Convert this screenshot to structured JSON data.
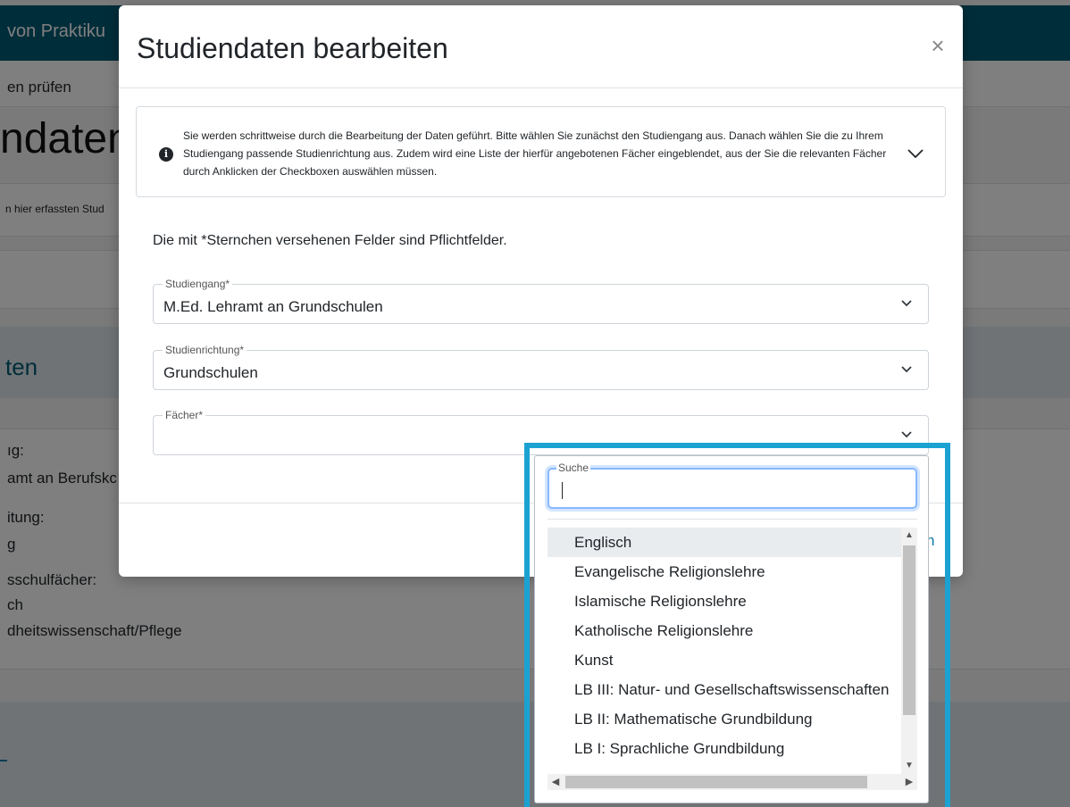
{
  "background": {
    "header_title": "von Praktiku",
    "subnav_text": "en prüfen",
    "page_title": "ndaten",
    "description": "n hier erfassten Stud",
    "section_title": "ten",
    "lines": [
      "ıg:",
      "amt an Berufskc",
      "itung:",
      "g",
      "sschulfächer:",
      "ch",
      "dheitswissenschaft/Pflege"
    ]
  },
  "modal": {
    "title": "Studiendaten bearbeiten",
    "close_symbol": "×",
    "info_icon": "i",
    "info_text": "Sie werden schrittweise durch die Bearbeitung der Daten geführt. Bitte wählen Sie zunächst den Studiengang aus. Danach wählen Sie die zu Ihrem Studiengang passende Studienrichtung aus. Zudem wird eine Liste der hierfür angebotenen Fächer eingeblendet, aus der Sie die relevanten Fächer durch Anklicken der Checkboxen auswählen müssen.",
    "required_note": "Die mit *Sternchen versehenen Felder sind Pflichtfelder.",
    "fields": {
      "studiengang": {
        "label": "Studiengang*",
        "value": "M.Ed. Lehramt an Grundschulen"
      },
      "studienrichtung": {
        "label": "Studienrichtung*",
        "value": "Grundschulen"
      },
      "faecher": {
        "label": "Fächer*",
        "value": ""
      }
    },
    "footer_partial": "n"
  },
  "dropdown": {
    "search_label": "Suche",
    "search_value": "",
    "items": [
      "Englisch",
      "Evangelische Religionslehre",
      "Islamische Religionslehre",
      "Katholische Religionslehre",
      "Kunst",
      "LB III: Natur- und Gesellschaftswissenschaften",
      "LB II: Mathematische Grundbildung",
      "LB I: Sprachliche Grundbildung"
    ],
    "active_item": "Englisch"
  },
  "colors": {
    "header": "#005b74",
    "highlight_frame": "#1ba2d2",
    "focus_ring": "#86b7fe"
  },
  "icons": {
    "close": "close-icon",
    "info": "info-circle-icon",
    "chevron": "chevron-down-icon"
  }
}
